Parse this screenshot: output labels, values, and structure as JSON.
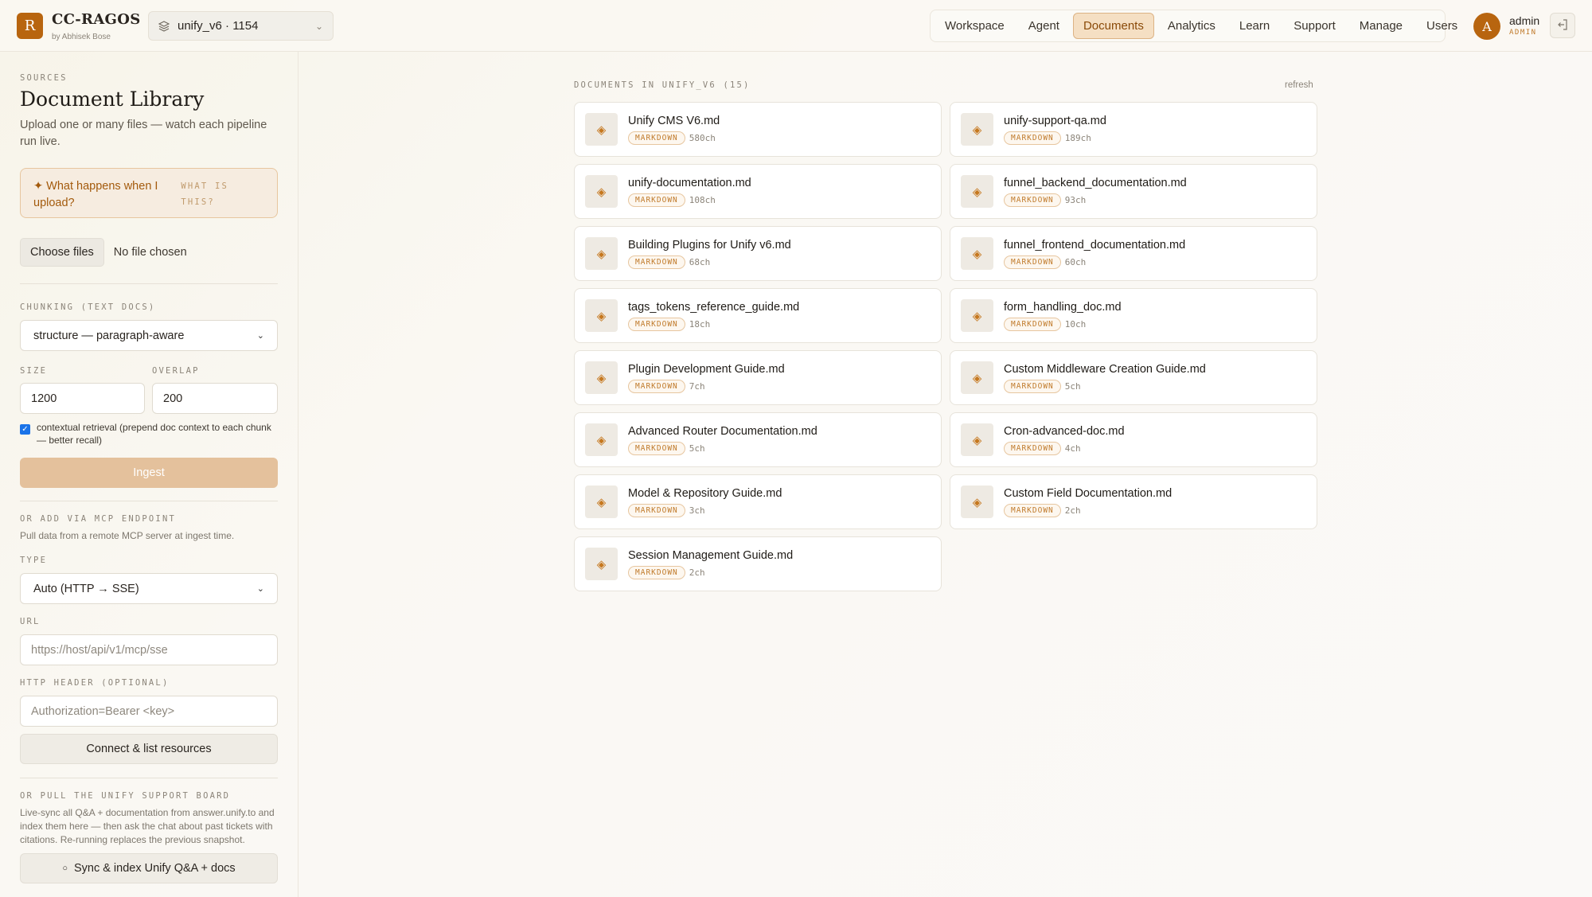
{
  "brand": {
    "logo_letter": "R",
    "name": "CC-RAGOS",
    "by": "by Abhisek Bose"
  },
  "workspace": {
    "label": "unify_v6 · 1154"
  },
  "nav": {
    "items": [
      {
        "label": "Workspace",
        "active": false
      },
      {
        "label": "Agent",
        "active": false
      },
      {
        "label": "Documents",
        "active": true
      },
      {
        "label": "Analytics",
        "active": false
      },
      {
        "label": "Learn",
        "active": false
      },
      {
        "label": "Support",
        "active": false
      },
      {
        "label": "Manage",
        "active": false
      },
      {
        "label": "Users",
        "active": false
      }
    ]
  },
  "user": {
    "avatar_letter": "A",
    "name": "admin",
    "role": "ADMIN"
  },
  "sidebar": {
    "section_label": "SOURCES",
    "title": "Document Library",
    "subtitle": "Upload one or many files — watch each pipeline run live.",
    "info": {
      "question": "✦ What happens when I upload?",
      "what_label": "WHAT IS THIS?"
    },
    "file": {
      "button_label": "Choose files",
      "status": "No file chosen"
    },
    "chunking": {
      "label": "CHUNKING (TEXT DOCS)",
      "value": "structure — paragraph-aware"
    },
    "size": {
      "label": "SIZE",
      "value": "1200"
    },
    "overlap": {
      "label": "OVERLAP",
      "value": "200"
    },
    "contextual": {
      "checked": true,
      "label": "contextual retrieval (prepend doc context to each chunk — better recall)"
    },
    "ingest_label": "Ingest",
    "mcp": {
      "section_label": "OR ADD VIA MCP ENDPOINT",
      "description": "Pull data from a remote MCP server at ingest time.",
      "type_label": "TYPE",
      "type_value": "Auto (HTTP → SSE)",
      "url_label": "URL",
      "url_placeholder": "https://host/api/v1/mcp/sse",
      "header_label": "HTTP HEADER (OPTIONAL)",
      "header_placeholder": "Authorization=Bearer <key>",
      "connect_label": "Connect & list resources"
    },
    "support": {
      "section_label": "OR PULL THE UNIFY SUPPORT BOARD",
      "description": "Live-sync all Q&A + documentation from answer.unify.to and index them here — then ask the chat about past tickets with citations. Re-running replaces the previous snapshot.",
      "sync_label": "Sync & index Unify Q&A + docs"
    }
  },
  "docs": {
    "header": "DOCUMENTS IN UNIFY_V6 (15)",
    "refresh_label": "refresh",
    "items": [
      {
        "name": "Unify CMS V6.md",
        "type": "MARKDOWN",
        "size": "580ch"
      },
      {
        "name": "unify-support-qa.md",
        "type": "MARKDOWN",
        "size": "189ch"
      },
      {
        "name": "unify-documentation.md",
        "type": "MARKDOWN",
        "size": "108ch"
      },
      {
        "name": "funnel_backend_documentation.md",
        "type": "MARKDOWN",
        "size": "93ch"
      },
      {
        "name": "Building Plugins for Unify v6.md",
        "type": "MARKDOWN",
        "size": "68ch"
      },
      {
        "name": "funnel_frontend_documentation.md",
        "type": "MARKDOWN",
        "size": "60ch"
      },
      {
        "name": "tags_tokens_reference_guide.md",
        "type": "MARKDOWN",
        "size": "18ch"
      },
      {
        "name": "form_handling_doc.md",
        "type": "MARKDOWN",
        "size": "10ch"
      },
      {
        "name": "Plugin Development Guide.md",
        "type": "MARKDOWN",
        "size": "7ch"
      },
      {
        "name": "Custom Middleware Creation Guide.md",
        "type": "MARKDOWN",
        "size": "5ch"
      },
      {
        "name": "Advanced Router Documentation.md",
        "type": "MARKDOWN",
        "size": "5ch"
      },
      {
        "name": "Cron-advanced-doc.md",
        "type": "MARKDOWN",
        "size": "4ch"
      },
      {
        "name": "Model & Repository Guide.md",
        "type": "MARKDOWN",
        "size": "3ch"
      },
      {
        "name": "Custom Field Documentation.md",
        "type": "MARKDOWN",
        "size": "2ch"
      },
      {
        "name": "Session Management Guide.md",
        "type": "MARKDOWN",
        "size": "2ch"
      }
    ]
  },
  "colors": {
    "accent": "#b8650f",
    "accent_light": "#f5dfc3",
    "ingest_disabled": "#e4c19c"
  }
}
